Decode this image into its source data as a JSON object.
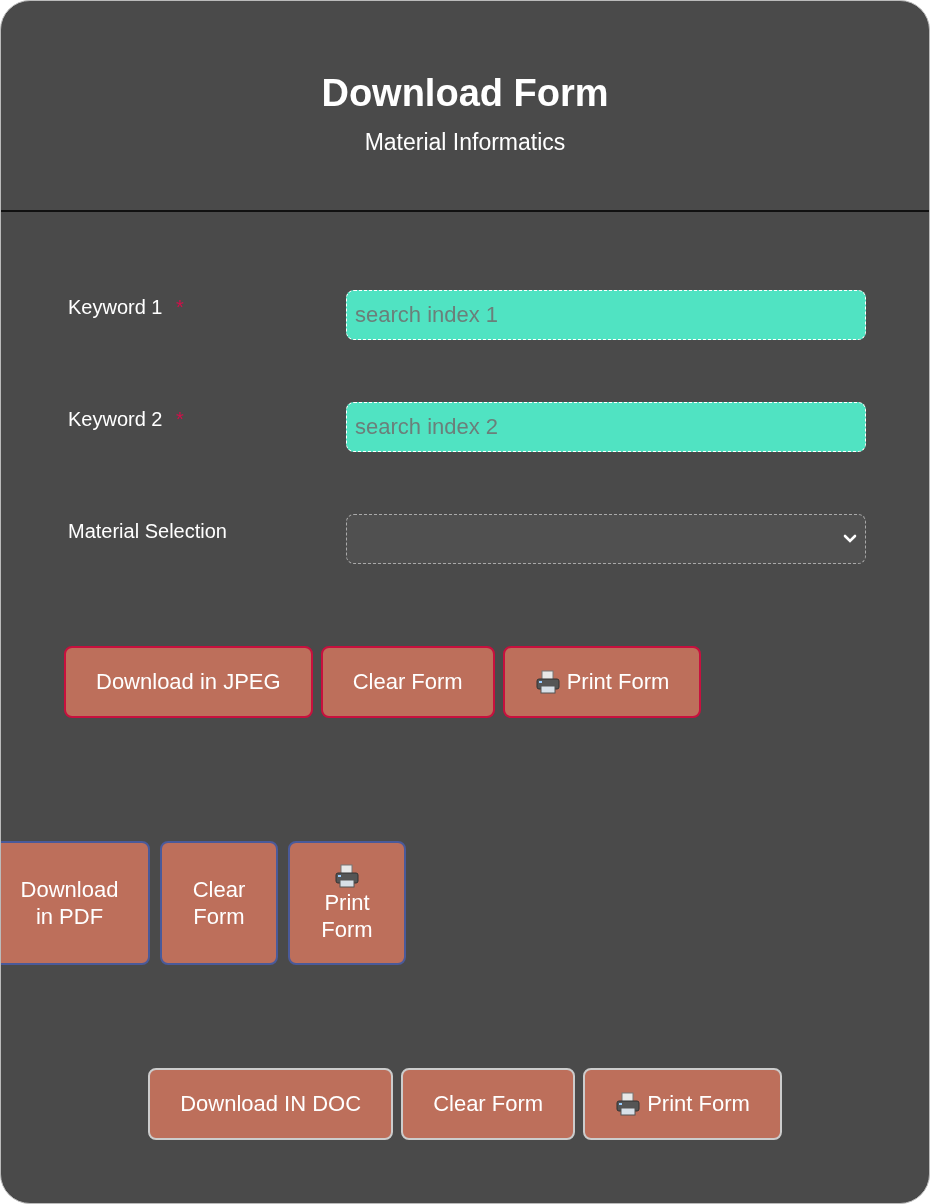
{
  "header": {
    "title": "Download Form",
    "subtitle": "Material Informatics"
  },
  "fields": [
    {
      "label": "Keyword 1",
      "required_marker": "*",
      "kind": "text",
      "placeholder": "search index 1"
    },
    {
      "label": "Keyword 2",
      "required_marker": "*",
      "kind": "text",
      "placeholder": "search index 2"
    },
    {
      "label": "Material Selection",
      "kind": "select"
    }
  ],
  "button_groups": [
    {
      "kind": "wide",
      "buttons": [
        {
          "kind": "download",
          "label": "Download in JPEG"
        },
        {
          "kind": "clear",
          "label": "Clear Form"
        },
        {
          "kind": "print",
          "label": "Print Form"
        }
      ]
    },
    {
      "kind": "narrow",
      "buttons": [
        {
          "kind": "download",
          "label": "Download in PDF"
        },
        {
          "kind": "clear",
          "label": "Clear Form"
        },
        {
          "kind": "print",
          "label": "Print Form"
        }
      ]
    },
    {
      "kind": "centered",
      "buttons": [
        {
          "kind": "download",
          "label": "Download IN DOC"
        },
        {
          "kind": "clear",
          "label": "Clear Form"
        },
        {
          "kind": "print",
          "label": "Print Form"
        }
      ]
    }
  ]
}
